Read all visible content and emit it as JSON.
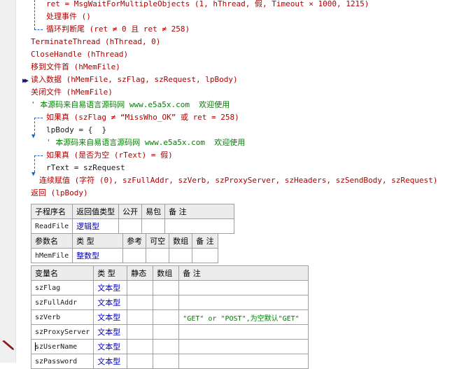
{
  "code": {
    "l1": "ret = MsgWaitForMultipleObjects (1, hThread, 假, Timeout × 1000, 1215)",
    "l2": "处理事件 ()",
    "l3": "循环判断尾 (ret ≠ 0 且 ret ≠ 258)",
    "l4": "TerminateThread (hThread, 0)",
    "l5": "CloseHandle (hThread)",
    "l6": "移到文件首 (hMemFile)",
    "l7": "读入数据 (hMemFile, szFlag, szRequest, lpBody)",
    "l8": "关闭文件 (hMemFile)",
    "l9": "' 本源码来自易语言源码网 www.e5a5x.com  欢迎使用",
    "l10": "如果真 (szFlag ≠ “MissWho_OK” 或 ret = 258)",
    "l11": "lpBody = {  }",
    "l12": "' 本源码来自易语言源码网 www.e5a5x.com  欢迎使用",
    "l13": "如果真 (是否为空 (rText) = 假)",
    "l14": "rText = szRequest",
    "l15": "连续赋值 (字符 (0), szFullAddr, szVerb, szProxyServer, szHeaders, szSendBody, szRequest)",
    "l16": "返回 (lpBody)"
  },
  "sub_table": {
    "headers": [
      "子程序名",
      "返回值类型",
      "公开",
      "易包",
      "备 注"
    ],
    "row": {
      "name": "ReadFile",
      "return_type": "逻辑型"
    }
  },
  "param_table": {
    "headers": [
      "参数名",
      "类 型",
      "参考",
      "可空",
      "数组",
      "备 注"
    ],
    "row": {
      "name": "hMemFile",
      "type": "整数型"
    }
  },
  "var_table": {
    "headers": [
      "变量名",
      "类 型",
      "静态",
      "数组",
      "备 注"
    ],
    "rows": [
      {
        "name": "szFlag",
        "type": "文本型",
        "note": ""
      },
      {
        "name": "szFullAddr",
        "type": "文本型",
        "note": ""
      },
      {
        "name": "szVerb",
        "type": "文本型",
        "note": "\"GET\" or \"POST\",为空默认\"GET\""
      },
      {
        "name": "szProxyServer",
        "type": "文本型",
        "note": ""
      },
      {
        "name": "szUserName",
        "type": "文本型",
        "note": ""
      },
      {
        "name": "szPassword",
        "type": "文本型",
        "note": ""
      }
    ]
  },
  "icons": [
    "execution-arrow-icon",
    "pencil-icon"
  ]
}
